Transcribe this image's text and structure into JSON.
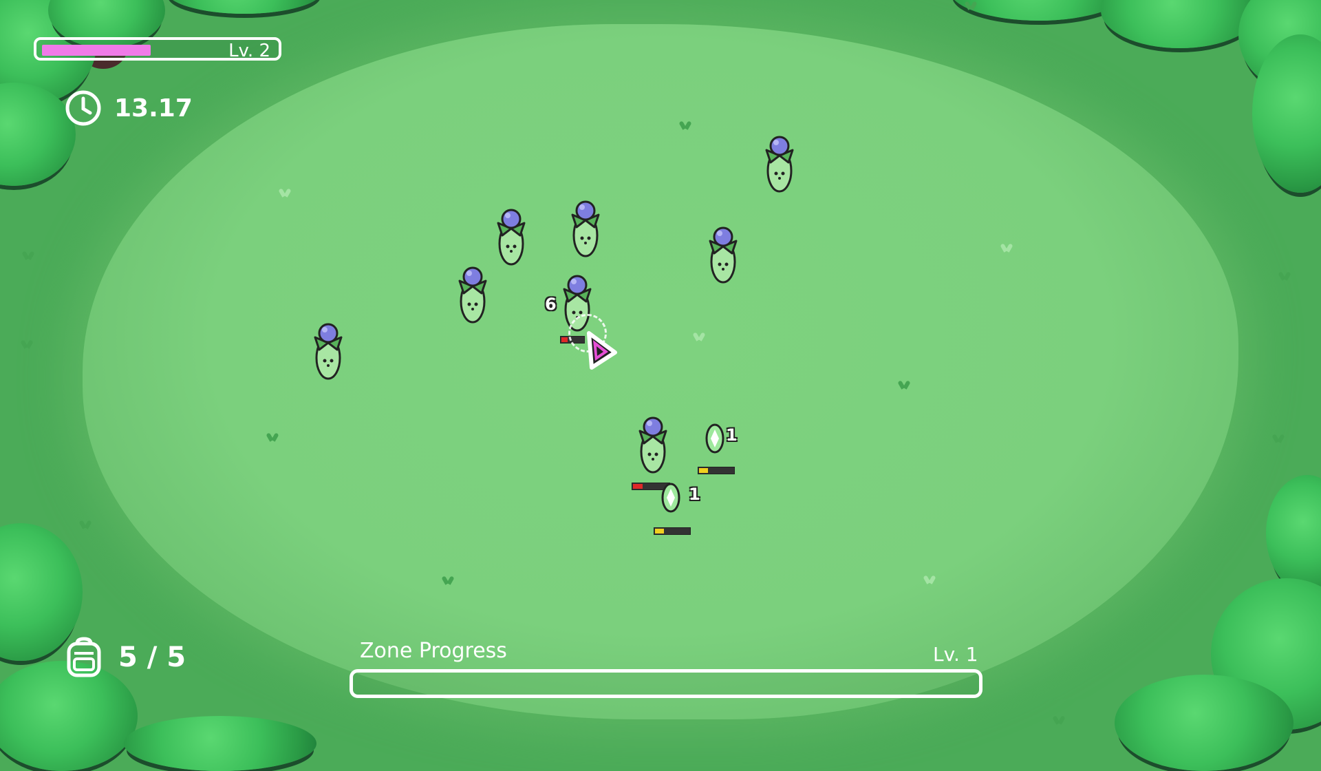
{
  "hud": {
    "xp_bar": {
      "level_text": "Lv. 2",
      "progress": 0.47,
      "fill_color": "#f07ae8"
    },
    "timer": {
      "icon": "clock-icon",
      "value": "13.17"
    },
    "inventory": {
      "icon": "backpack-icon",
      "value": "5 / 5"
    },
    "zone": {
      "label": "Zone Progress",
      "level_text": "Lv. 1",
      "progress": 0.0
    }
  },
  "combat": {
    "damage_number": "6",
    "gem_labels": [
      "1",
      "1"
    ],
    "enemy_health_fraction": 0.25,
    "gem_charge_fraction": 0.25
  },
  "colors": {
    "grass": "#7bd07d",
    "forest": "#3cbf5a",
    "enemy_body": "#a8e6a3",
    "enemy_head": "#7e7ee0",
    "player_accent": "#e64fd6"
  }
}
